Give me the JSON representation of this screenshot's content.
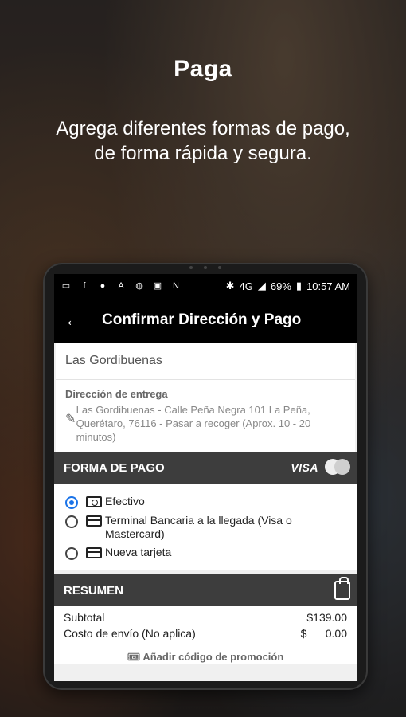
{
  "hero": {
    "title": "Paga",
    "subtitle": "Agrega diferentes formas de pago, de forma rápida y segura."
  },
  "statusbar": {
    "icons": [
      "message-icon",
      "facebook-icon",
      "location-icon",
      "pdf-icon",
      "globe-icon",
      "gallery-icon",
      "n-icon",
      "bluetooth-icon"
    ],
    "network": "4G",
    "battery": "69%",
    "time": "10:57 AM"
  },
  "appbar": {
    "title": "Confirmar Dirección y Pago"
  },
  "restaurant": {
    "name": "Las Gordibuenas"
  },
  "address": {
    "label": "Dirección de entrega",
    "text": "Las Gordibuenas - Calle Peña Negra 101 La Peña, Querétaro, 76116 - Pasar a recoger (Aprox. 10 - 20 minutos)"
  },
  "payment": {
    "header": "FORMA DE PAGO",
    "visa": "VISA",
    "options": [
      {
        "label": "Efectivo",
        "icon": "cash-icon",
        "selected": true
      },
      {
        "label": "Terminal Bancaria a la llegada (Visa o Mastercard)",
        "icon": "credit-card-icon",
        "selected": false
      },
      {
        "label": "Nueva tarjeta",
        "icon": "credit-card-icon",
        "selected": false
      }
    ]
  },
  "summary": {
    "header": "RESUMEN",
    "subtotal_label": "Subtotal",
    "subtotal_value": "$139.00",
    "shipping_label": "Costo de envío (No aplica)",
    "shipping_value": "$      0.00"
  },
  "promo": {
    "label": "Añadir código de promoción"
  },
  "colors": {
    "accent": "#1a73e8",
    "section_bar": "#3d3d3d",
    "appbar": "#000000"
  }
}
